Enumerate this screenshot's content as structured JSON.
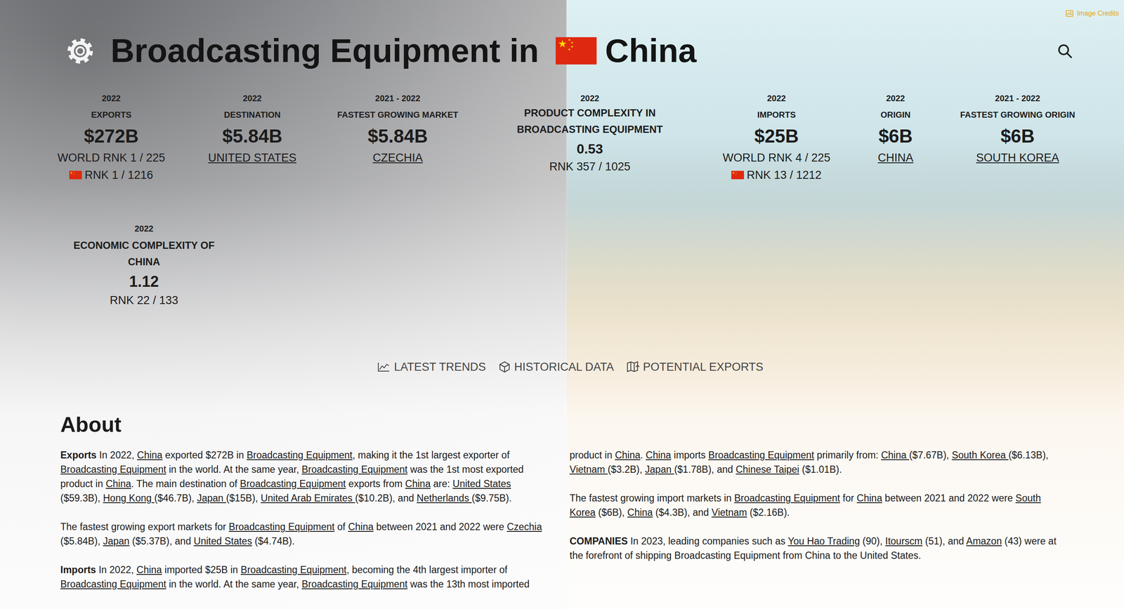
{
  "header": {
    "title": "Broadcasting Equipment in",
    "country": "China",
    "image_credits": "Image Credits"
  },
  "stats": [
    {
      "kind": "rank",
      "year": "2022",
      "label": "EXPORTS",
      "value": "$272B",
      "sub": "WORLD RNK 1 / 225",
      "sub2": "RNK 1 / 1216"
    },
    {
      "kind": "link",
      "year": "2022",
      "label": "DESTINATION",
      "value": "$5.84B",
      "sub": "UNITED STATES"
    },
    {
      "kind": "link",
      "year": "2021 - 2022",
      "label": "FASTEST GROWING MARKET",
      "value": "$5.84B",
      "sub": "CZECHIA"
    },
    {
      "kind": "complexity",
      "year": "2022",
      "label": "PRODUCT COMPLEXITY IN BROADCASTING EQUIPMENT",
      "value": "0.53",
      "sub": "RNK 357 / 1025"
    },
    {
      "kind": "rank",
      "year": "2022",
      "label": "IMPORTS",
      "value": "$25B",
      "sub": "WORLD RNK 4 / 225",
      "sub2": "RNK 13 / 1212"
    },
    {
      "kind": "link",
      "year": "2022",
      "label": "ORIGIN",
      "value": "$6B",
      "sub": "CHINA"
    },
    {
      "kind": "link",
      "year": "2021 - 2022",
      "label": "FASTEST GROWING ORIGIN",
      "value": "$6B",
      "sub": "SOUTH KOREA"
    }
  ],
  "economic_complexity": {
    "year": "2022",
    "label": "ECONOMIC COMPLEXITY OF CHINA",
    "value": "1.12",
    "sub": "RNK 22 / 133"
  },
  "tabs": [
    {
      "label": "LATEST TRENDS",
      "selected": false
    },
    {
      "label": "HISTORICAL DATA",
      "selected": false
    },
    {
      "label": "POTENTIAL EXPORTS",
      "selected": false
    }
  ],
  "about": {
    "heading": "About",
    "paragraphs": [
      {
        "lead": "Exports",
        "segments": [
          {
            "text": " In 2022, ",
            "link": false
          },
          {
            "text": "China",
            "link": true
          },
          {
            "text": " exported $272B in ",
            "link": false
          },
          {
            "text": "Broadcasting Equipment",
            "link": true
          },
          {
            "text": ", making it the 1st largest exporter of ",
            "link": false
          },
          {
            "text": "Broadcasting Equipment",
            "link": true
          },
          {
            "text": " in the world. At the same year, ",
            "link": false
          },
          {
            "text": "Broadcasting Equipment",
            "link": true
          },
          {
            "text": " was the 1st most exported product in ",
            "link": false
          },
          {
            "text": "China",
            "link": true
          },
          {
            "text": ". The main destination of ",
            "link": false
          },
          {
            "text": "Broadcasting Equipment",
            "link": true
          },
          {
            "text": " exports from ",
            "link": false
          },
          {
            "text": "China",
            "link": true
          },
          {
            "text": " are: ",
            "link": false
          },
          {
            "text": "United States",
            "link": true
          },
          {
            "text": " ($59.3B), ",
            "link": false
          },
          {
            "text": "Hong Kong ",
            "link": true
          },
          {
            "text": "($46.7B), ",
            "link": false
          },
          {
            "text": "Japan ",
            "link": true
          },
          {
            "text": "($15B), ",
            "link": false
          },
          {
            "text": "United Arab Emirates ",
            "link": true
          },
          {
            "text": "($10.2B), and ",
            "link": false
          },
          {
            "text": "Netherlands ",
            "link": true
          },
          {
            "text": "($9.75B).",
            "link": false
          }
        ]
      },
      {
        "lead": "",
        "segments": [
          {
            "text": "The fastest growing export markets for ",
            "link": false
          },
          {
            "text": "Broadcasting Equipment",
            "link": true
          },
          {
            "text": " of ",
            "link": false
          },
          {
            "text": "China",
            "link": true
          },
          {
            "text": " between 2021 and 2022 were ",
            "link": false
          },
          {
            "text": "Czechia",
            "link": true
          },
          {
            "text": " ($5.84B), ",
            "link": false
          },
          {
            "text": "Japan",
            "link": true
          },
          {
            "text": " ($5.37B), and ",
            "link": false
          },
          {
            "text": "United States",
            "link": true
          },
          {
            "text": " ($4.74B).",
            "link": false
          }
        ]
      },
      {
        "lead": "Imports",
        "segments": [
          {
            "text": " In 2022, ",
            "link": false
          },
          {
            "text": "China",
            "link": true
          },
          {
            "text": " imported $25B in ",
            "link": false
          },
          {
            "text": "Broadcasting Equipment",
            "link": true
          },
          {
            "text": ", becoming the 4th largest importer of ",
            "link": false
          },
          {
            "text": "Broadcasting Equipment",
            "link": true
          },
          {
            "text": " in the world. At the same year, ",
            "link": false
          },
          {
            "text": "Broadcasting Equipment",
            "link": true
          },
          {
            "text": " was the 13th most imported product in ",
            "link": false
          },
          {
            "text": "China",
            "link": true
          },
          {
            "text": ". ",
            "link": false
          },
          {
            "text": "China",
            "link": true
          },
          {
            "text": " imports ",
            "link": false
          },
          {
            "text": "Broadcasting Equipment",
            "link": true
          },
          {
            "text": " primarily from: ",
            "link": false
          },
          {
            "text": "China ",
            "link": true
          },
          {
            "text": "($7.67B), ",
            "link": false
          },
          {
            "text": "South Korea ",
            "link": true
          },
          {
            "text": "($6.13B), ",
            "link": false
          },
          {
            "text": "Vietnam ",
            "link": true
          },
          {
            "text": "($3.2B), ",
            "link": false
          },
          {
            "text": "Japan ",
            "link": true
          },
          {
            "text": "($1.78B), and ",
            "link": false
          },
          {
            "text": "Chinese Taipei",
            "link": true
          },
          {
            "text": " ($1.01B).",
            "link": false
          }
        ]
      },
      {
        "lead": "",
        "segments": [
          {
            "text": "The fastest growing import markets in ",
            "link": false
          },
          {
            "text": "Broadcasting Equipment",
            "link": true
          },
          {
            "text": " for ",
            "link": false
          },
          {
            "text": "China",
            "link": true
          },
          {
            "text": " between 2021 and 2022 were ",
            "link": false
          },
          {
            "text": "South Korea",
            "link": true
          },
          {
            "text": " ($6B), ",
            "link": false
          },
          {
            "text": "China",
            "link": true
          },
          {
            "text": " ($4.3B), and ",
            "link": false
          },
          {
            "text": "Vietnam",
            "link": true
          },
          {
            "text": " ($2.16B).",
            "link": false
          }
        ]
      },
      {
        "lead": "COMPANIES",
        "segments": [
          {
            "text": " In 2023, leading companies such as ",
            "link": false
          },
          {
            "text": "You Hao Trading",
            "link": true
          },
          {
            "text": " (90), ",
            "link": false
          },
          {
            "text": "Itourscm",
            "link": true
          },
          {
            "text": " (51), and ",
            "link": false
          },
          {
            "text": "Amazon",
            "link": true
          },
          {
            "text": " (43) were at the forefront of shipping Broadcasting Equipment from China to the United States.",
            "link": false
          }
        ]
      }
    ]
  }
}
